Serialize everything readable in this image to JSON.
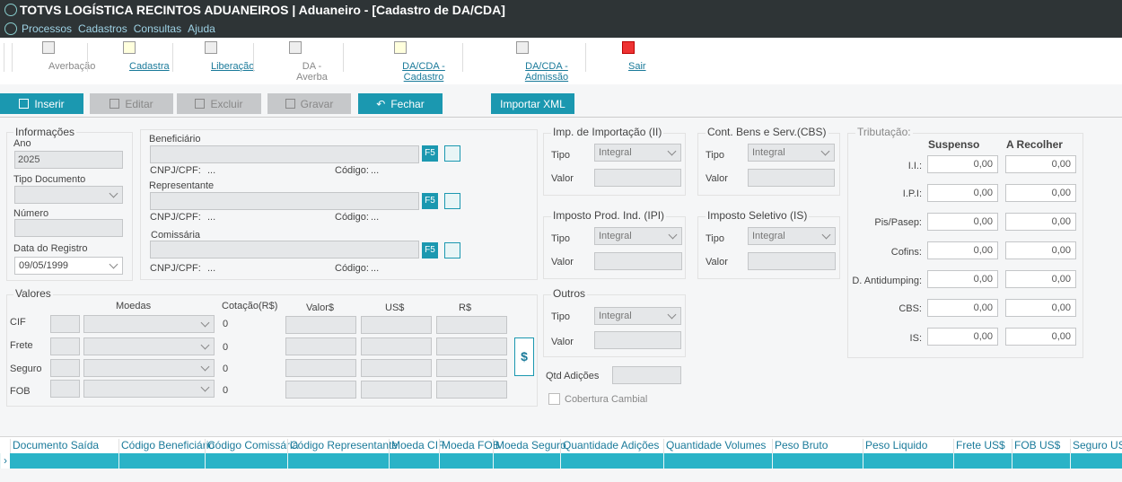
{
  "app": {
    "title": "TOTVS LOGÍSTICA RECINTOS ADUANEIROS | Aduaneiro - [Cadastro de DA/CDA]",
    "menu": [
      "Processos",
      "Cadastros",
      "Consultas",
      "Ajuda"
    ]
  },
  "toolbar": {
    "items": [
      {
        "label": "Averbação"
      },
      {
        "label": "Cadastra"
      },
      {
        "label": "Liberação"
      },
      {
        "label": "DA - Averba"
      },
      {
        "label": "DA/CDA - Cadastro"
      },
      {
        "label": "DA/CDA - Admissão"
      },
      {
        "label": "Sair"
      }
    ]
  },
  "actions": {
    "inserir": "Inserir",
    "editar": "Editar",
    "excluir": "Excluir",
    "gravar": "Gravar",
    "fechar": "Fechar",
    "importar": "Importar XML"
  },
  "info": {
    "title": "Informações",
    "ano_label": "Ano",
    "ano": "2025",
    "tipo_label": "Tipo Documento",
    "numero_label": "Número",
    "data_label": "Data do Registro",
    "data": "09/05/1999"
  },
  "partes": {
    "beneficiario": "Beneficiário",
    "representante": "Representante",
    "comissaria": "Comissária",
    "cnpj": "CNPJ/CPF:",
    "codigo": "Código:",
    "dots": "...",
    "f5": "F5"
  },
  "valores": {
    "title": "Valores",
    "moedas": "Moedas",
    "cotacao": "Cotação(R$)",
    "valor": "Valor$",
    "us": "US$",
    "rs": "R$",
    "rows": [
      {
        "label": "CIF",
        "cot": "0"
      },
      {
        "label": "Frete",
        "cot": "0"
      },
      {
        "label": "Seguro",
        "cot": "0"
      },
      {
        "label": "FOB",
        "cot": "0"
      }
    ],
    "dollar": "$"
  },
  "impostos": {
    "tipo": "Tipo",
    "valor": "Valor",
    "ii": "Imp. de Importação (II)",
    "ipi": "Imposto Prod. Ind. (IPI)",
    "outros": "Outros",
    "cbs": "Cont. Bens e Serv.(CBS)",
    "is": "Imposto Seletivo (IS)",
    "integral": "Integral"
  },
  "qtd": {
    "label": "Qtd Adições",
    "cobertura": "Cobertura Cambial"
  },
  "tributacao": {
    "title": "Tributação:",
    "suspenso": "Suspenso",
    "recolher": "A Recolher",
    "rows": [
      {
        "label": "I.I.:",
        "s": "0,00",
        "r": "0,00"
      },
      {
        "label": "I.P.I:",
        "s": "0,00",
        "r": "0,00"
      },
      {
        "label": "Pis/Pasep:",
        "s": "0,00",
        "r": "0,00"
      },
      {
        "label": "Cofins:",
        "s": "0,00",
        "r": "0,00"
      },
      {
        "label": "D. Antidumping:",
        "s": "0,00",
        "r": "0,00"
      },
      {
        "label": "CBS:",
        "s": "0,00",
        "r": "0,00"
      },
      {
        "label": "IS:",
        "s": "0,00",
        "r": "0,00"
      }
    ]
  },
  "grid": {
    "columns": [
      "Documento Saída",
      "Código Beneficiário",
      "Código Comissária",
      "Código Representante",
      "Moeda CIF",
      "Moeda FOB",
      "Moeda Seguro",
      "Quantidade Adições",
      "Quantidade Volumes",
      "Peso Bruto",
      "Peso Liquido",
      "Frete US$",
      "FOB US$",
      "Seguro US$"
    ]
  }
}
